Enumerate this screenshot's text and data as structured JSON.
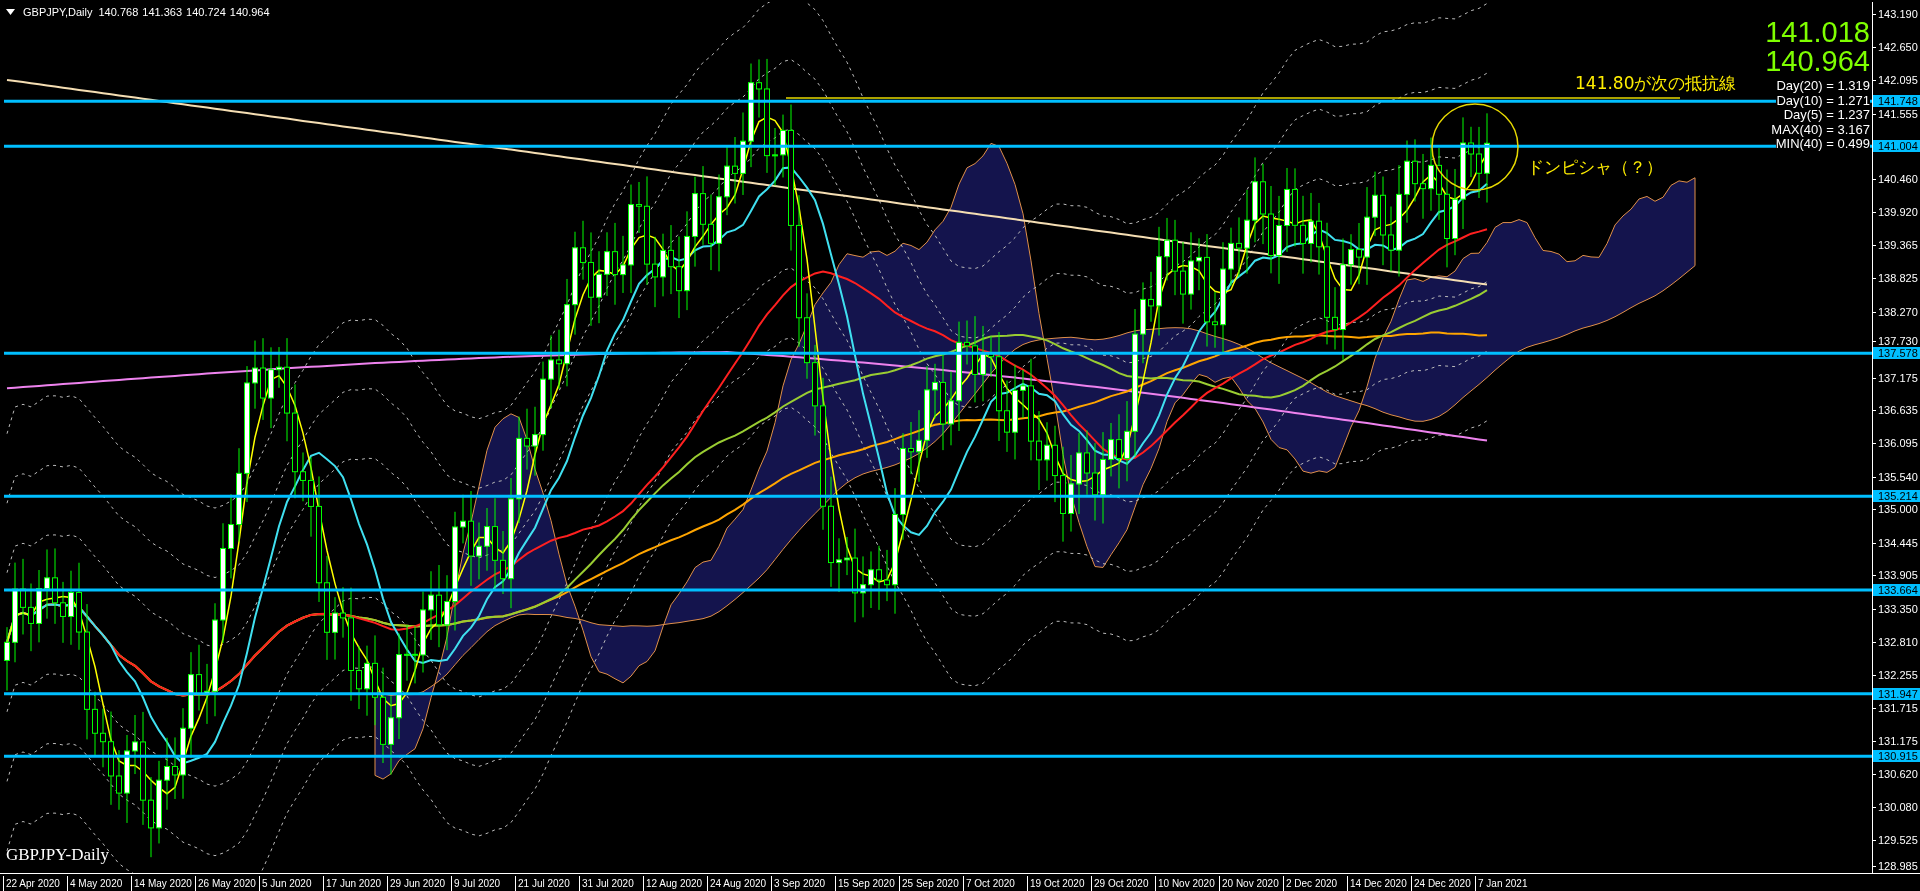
{
  "header": {
    "symbol": "GBPJPY,Daily",
    "ohlc": [
      "140.768",
      "141.363",
      "140.724",
      "140.964"
    ]
  },
  "price_display": [
    "141.018",
    "140.964"
  ],
  "statistics": [
    "Day(20) = 1.319",
    "Day(10) = 1.271",
    "Day(5) = 1.237",
    "MAX(40) = 3.167",
    "MIN(40) = 0.499"
  ],
  "resistance_note": "141.80が次の抵抗線",
  "circle_note": "ドンピシャ（？）",
  "chart_label": "GBPJPY-Daily",
  "level_lines": [
    {
      "label": "141.748"
    },
    {
      "label": "141.004"
    },
    {
      "label": "137.578"
    },
    {
      "label": "135.214"
    },
    {
      "label": "133.664"
    },
    {
      "label": "131.947"
    },
    {
      "label": "130.915"
    }
  ],
  "y_axis": {
    "ticks": [
      "143.190",
      "142.650",
      "142.095",
      "141.555",
      "140.460",
      "139.920",
      "139.365",
      "138.825",
      "138.270",
      "137.730",
      "137.175",
      "136.635",
      "136.095",
      "135.540",
      "135.000",
      "134.445",
      "133.905",
      "133.350",
      "132.810",
      "132.255",
      "131.715",
      "131.175",
      "130.620",
      "130.080",
      "129.525",
      "128.985"
    ]
  },
  "x_axis": {
    "dates": [
      "22 Apr 2020",
      "4 May 2020",
      "14 May 2020",
      "26 May 2020",
      "5 Jun 2020",
      "17 Jun 2020",
      "29 Jun 2020",
      "9 Jul 2020",
      "21 Jul 2020",
      "31 Jul 2020",
      "12 Aug 2020",
      "24 Aug 2020",
      "3 Sep 2020",
      "15 Sep 2020",
      "25 Sep 2020",
      "7 Oct 2020",
      "19 Oct 2020",
      "29 Oct 2020",
      "10 Nov 2020",
      "20 Nov 2020",
      "2 Dec 2020",
      "14 Dec 2020",
      "24 Dec 2020",
      "7 Jan 2021"
    ]
  }
}
